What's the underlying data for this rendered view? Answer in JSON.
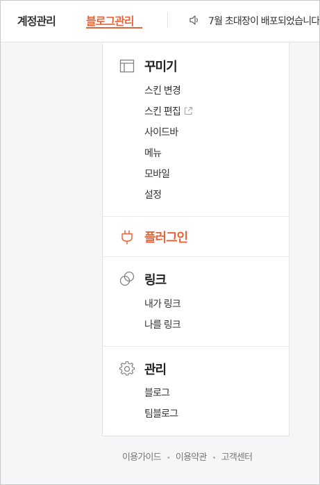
{
  "header": {
    "tabs": [
      {
        "label": "계정관리",
        "active": false
      },
      {
        "label": "블로그관리",
        "active": true
      }
    ],
    "notice": {
      "icon": "speaker-icon",
      "text": "7월 초대장이 배포되었습니다"
    }
  },
  "menu": {
    "decorate": {
      "icon": "layout-icon",
      "title": "꾸미기",
      "items": [
        "스킨 변경",
        "스킨 편집",
        "사이드바",
        "메뉴",
        "모바일",
        "설정"
      ],
      "external_item_icon": "external-link-icon"
    },
    "plugin": {
      "icon": "plug-icon",
      "title": "플러그인"
    },
    "link": {
      "icon": "link-circles-icon",
      "title": "링크",
      "items": [
        "내가 링크",
        "나를 링크"
      ]
    },
    "manage": {
      "icon": "gear-icon",
      "title": "관리",
      "items": [
        "블로그",
        "팀블로그"
      ]
    }
  },
  "footer": {
    "links": [
      "이용가이드",
      "이용약관",
      "고객센터"
    ]
  },
  "colors": {
    "accent": "#e5653b",
    "background": "#f5f6f8"
  }
}
